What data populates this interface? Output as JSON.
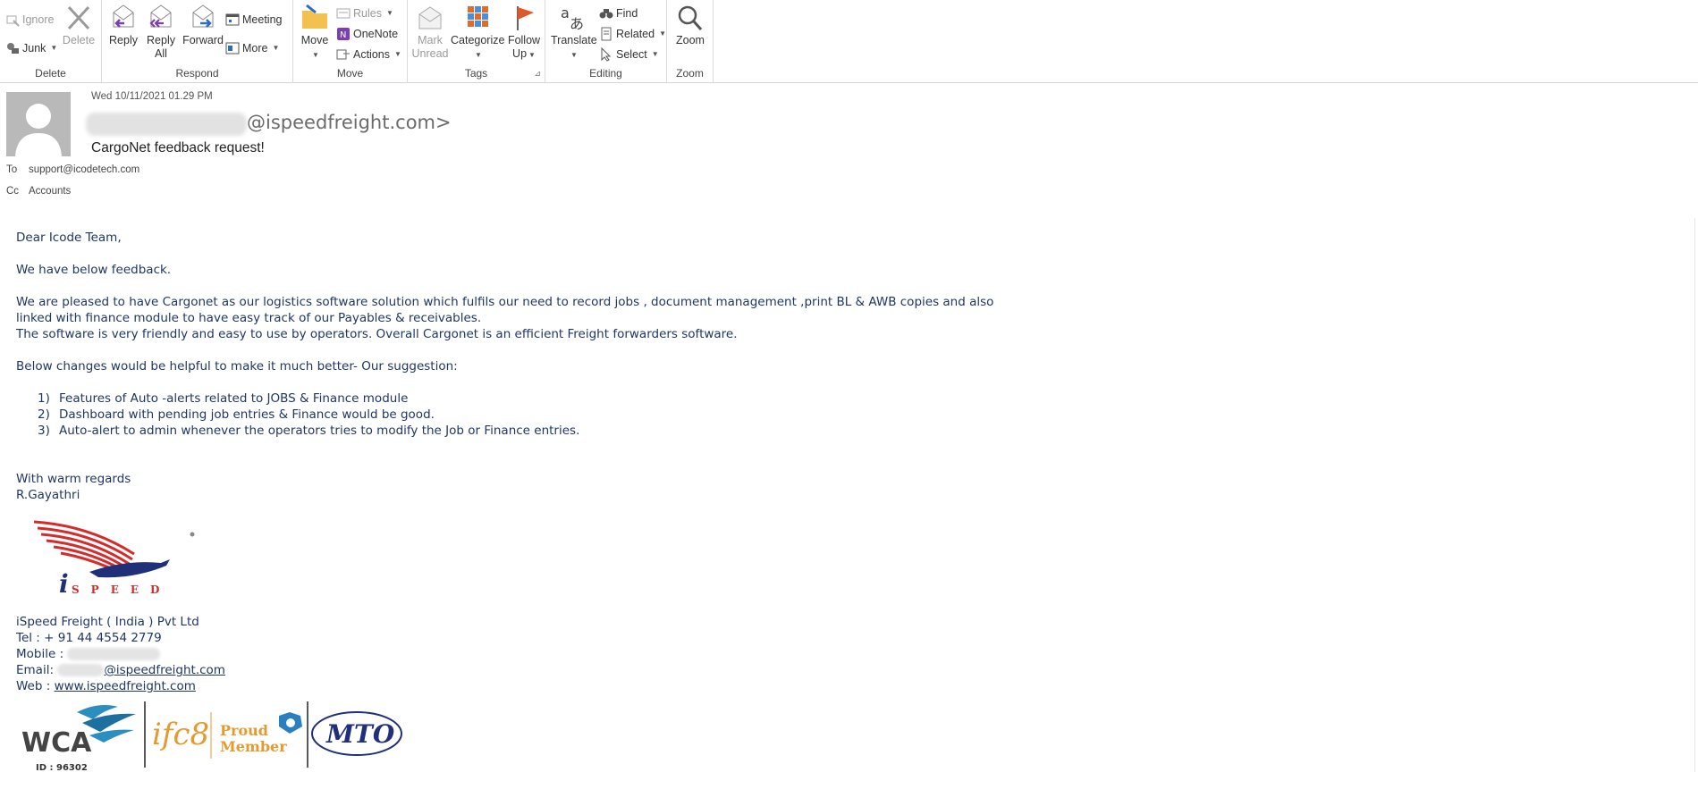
{
  "ribbon": {
    "groups": {
      "delete": "Delete",
      "respond": "Respond",
      "move": "Move",
      "tags": "Tags",
      "editing": "Editing",
      "zoom": "Zoom"
    },
    "ignore": "Ignore",
    "junk": "Junk",
    "delete": "Delete",
    "reply": "Reply",
    "reply_all_1": "Reply",
    "reply_all_2": "All",
    "forward": "Forward",
    "meeting": "Meeting",
    "more": "More",
    "move": "Move",
    "rules": "Rules",
    "onenote": "OneNote",
    "actions": "Actions",
    "mark_unread_1": "Mark",
    "mark_unread_2": "Unread",
    "categorize": "Categorize",
    "follow_up_1": "Follow",
    "follow_up_2": "Up",
    "translate": "Translate",
    "find": "Find",
    "related": "Related",
    "select": "Select",
    "zoom": "Zoom"
  },
  "message": {
    "date": "Wed 10/11/2021 01.29 PM",
    "sender_domain": "@ispeedfreight.com>",
    "subject": "CargoNet feedback request!",
    "to_label": "To",
    "to_value": "support@icodetech.com",
    "cc_label": "Cc",
    "cc_value": "Accounts"
  },
  "body": {
    "greeting": "Dear Icode Team,",
    "intro": "We have below feedback.",
    "para1_line1": "We are pleased to have Cargonet as our logistics software solution which fulfils our need to  record jobs , document management ,print BL & AWB copies and also",
    "para1_line2": "linked with finance module to have easy track of our Payables & receivables.",
    "para1_line3": "The software is very friendly and easy to use by operators. Overall Cargonet is an efficient Freight forwarders software.",
    "suggest_intro": "Below changes would be helpful to make it much better- Our suggestion:",
    "list": [
      {
        "num": "1)",
        "text": "Features of Auto -alerts related to JOBS & Finance module"
      },
      {
        "num": "2)",
        "text": "Dashboard with pending job entries & Finance would be good."
      },
      {
        "num": "3)",
        "text": "Auto-alert to admin whenever the operators tries to modify the Job or Finance entries."
      }
    ],
    "regards": "With warm regards",
    "name": "R.Gayathri"
  },
  "signature": {
    "logo_text": "iSPEED",
    "company": "iSpeed Freight ( India ) Pvt Ltd",
    "tel": "Tel : + 91 44 4554 2779",
    "mobile_label": "Mobile :",
    "email_label": "Email:",
    "email_domain": "@ispeedfreight.com",
    "web_label": "Web :",
    "web_link": "www.ispeedfreight.com",
    "wca": "WCA",
    "wca_id": "ID : 96302",
    "ifc": "ifc8",
    "proud": "Proud",
    "member": "Member",
    "mto": "MTO"
  },
  "colors": {
    "body_text": "#1f3763",
    "brand_red": "#d62b2b",
    "brand_blue": "#1f2f7a",
    "ifc_orange": "#e69a2e"
  }
}
